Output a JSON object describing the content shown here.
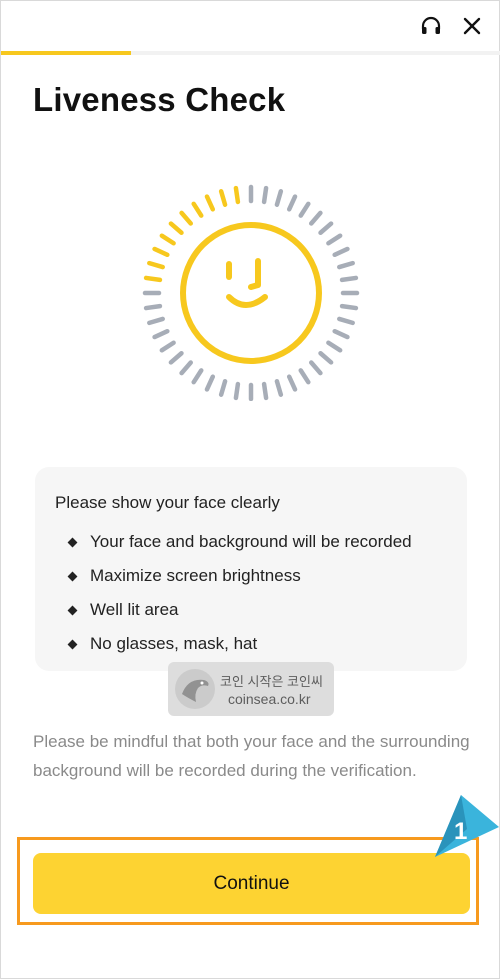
{
  "header": {
    "support_icon": "headset-icon",
    "close_icon": "close-icon"
  },
  "progress": {
    "fraction": 0.26,
    "color": "#f7c81e"
  },
  "title": "Liveness Check",
  "illustration": {
    "icon": "smiley-face-icon",
    "accent": "#f7c81e",
    "ring_secondary": "#a7adb7"
  },
  "info": {
    "heading": "Please show your face clearly",
    "items": [
      "Your face and background will be recorded",
      "Maximize screen brightness",
      "Well lit area",
      "No glasses, mask, hat"
    ]
  },
  "watermark": {
    "korean": "코인 시작은 코인씨",
    "url": "coinsea.co.kr"
  },
  "note": "Please be mindful that both your face and the surrounding background will be recorded during the verification.",
  "cta": {
    "label": "Continue",
    "color": "#fdd332"
  },
  "annotation": {
    "number": "1",
    "outline_color": "#f79a1e",
    "arrow_color": "#3ab4dc"
  }
}
